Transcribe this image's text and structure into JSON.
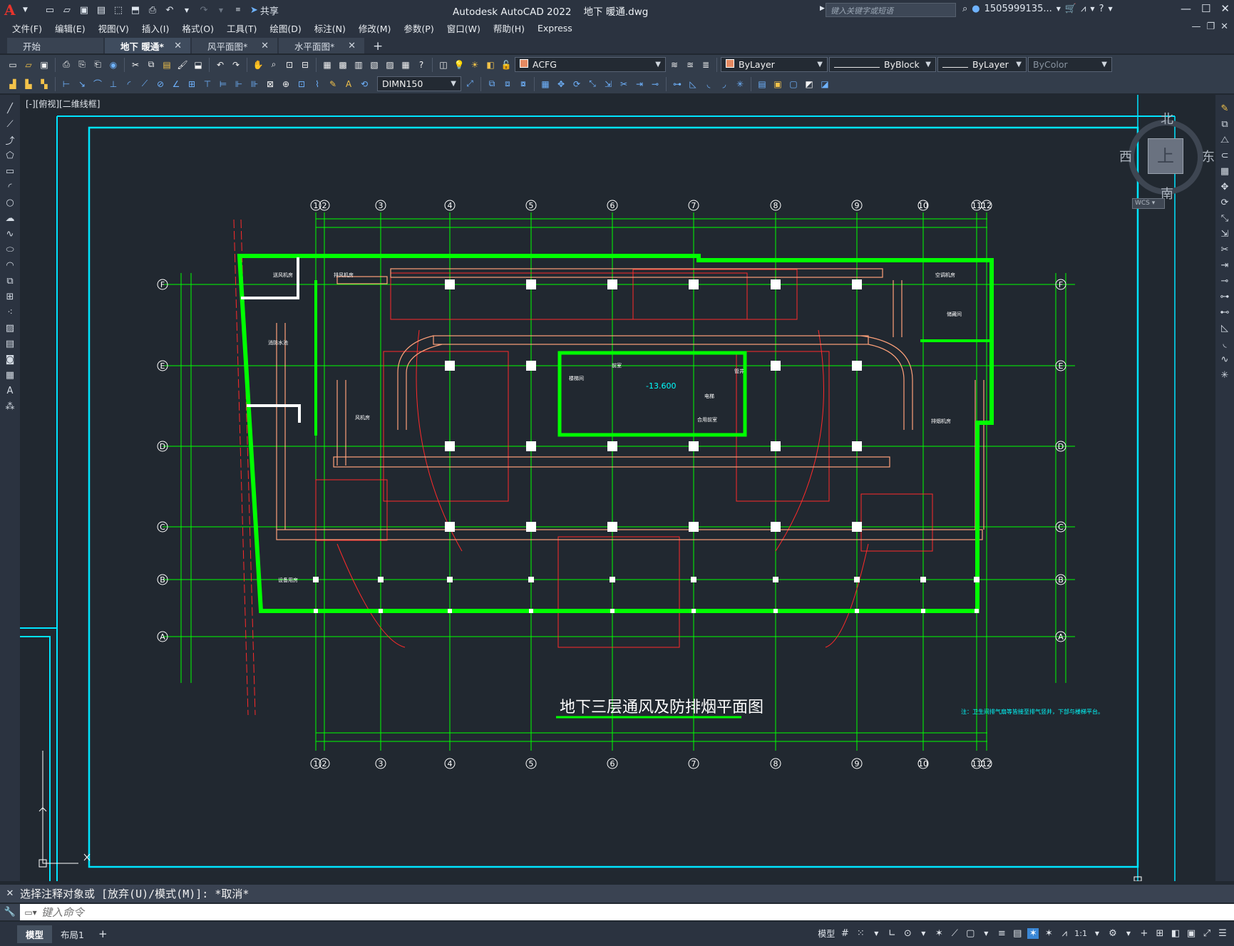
{
  "titlebar": {
    "app_name": "Autodesk AutoCAD 2022",
    "file_name": "地下 暖通.dwg",
    "share_label": "共享",
    "search_placeholder": "键入关键字或短语",
    "user_name": "1505999135..."
  },
  "menubar": {
    "items": [
      "文件(F)",
      "编辑(E)",
      "视图(V)",
      "插入(I)",
      "格式(O)",
      "工具(T)",
      "绘图(D)",
      "标注(N)",
      "修改(M)",
      "参数(P)",
      "窗口(W)",
      "帮助(H)",
      "Express"
    ]
  },
  "tabs": {
    "items": [
      "开始",
      "地下 暖通*",
      "风平面图*",
      "水平面图*"
    ]
  },
  "toolbar": {
    "layer_name": "ACFG",
    "color": "ByLayer",
    "linetype": "ByBlock",
    "lineweight": "ByLayer",
    "plotstyle": "ByColor",
    "dimstyle": "DIMN150"
  },
  "viewport": {
    "label": "[-][俯视][二维线框]",
    "navcube": {
      "north": "北",
      "south": "南",
      "east": "东",
      "west": "西",
      "top_face": "上",
      "wcs": "WCS"
    }
  },
  "drawing": {
    "title": "地下三层通风及防排烟平面图",
    "note": "注：卫生间排气扇等皆接至排气竖井，下部与楼梯平台。",
    "column_labels": [
      "1",
      "2",
      "3",
      "4",
      "5",
      "6",
      "7",
      "8",
      "9",
      "10",
      "11",
      "12"
    ],
    "row_labels": [
      "F",
      "E",
      "D",
      "C",
      "B",
      "A"
    ],
    "elevation_tag": "-13.600",
    "room_labels": [
      "送风机房",
      "排风机房",
      "消防水池",
      "风机房",
      "空调机房",
      "管井",
      "前室",
      "楼梯间",
      "电梯",
      "合用前室",
      "排烟机房",
      "储藏间",
      "设备用房"
    ],
    "colors": {
      "background": "#212830",
      "wall": "#00ff00",
      "duct": "#ffa17a",
      "grid": "#00ff00",
      "redline": "#ff2a2a",
      "frame": "#00e5ff",
      "axis_bubble": "#ffffff"
    }
  },
  "command": {
    "history": "选择注释对象或 [放弃(U)/模式(M)]: *取消*",
    "placeholder": "键入命令"
  },
  "statusbar": {
    "layout_tabs": [
      "模型",
      "布局1"
    ],
    "model_label": "模型",
    "scale": "1:1"
  }
}
